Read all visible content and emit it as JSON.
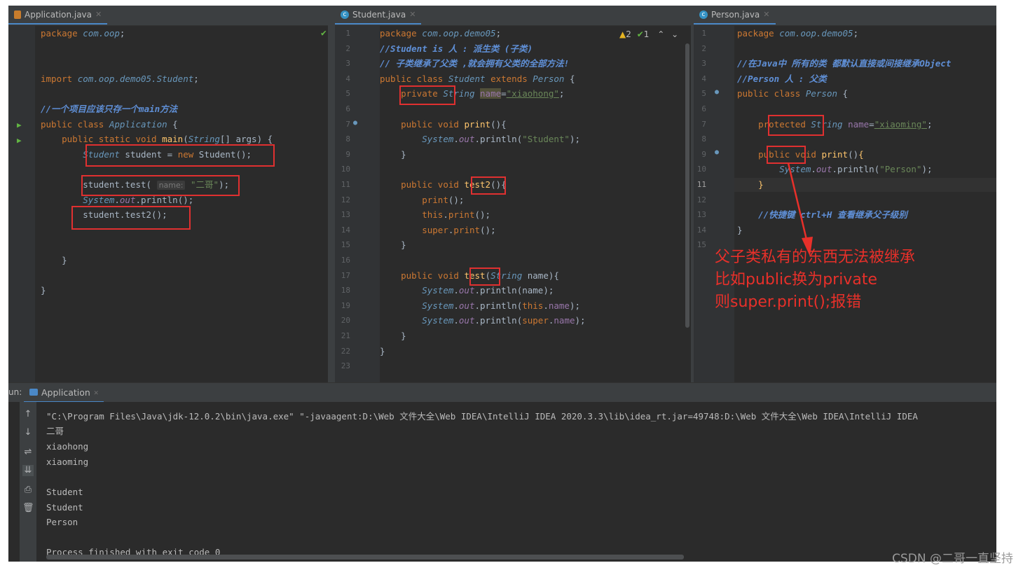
{
  "tabs": {
    "app": "Application.java",
    "student": "Student.java",
    "person": "Person.java"
  },
  "inspection": {
    "warnings": "2",
    "checks": "1"
  },
  "run": {
    "prefix": "un:",
    "tab_label": "Application",
    "output": [
      "\"C:\\Program Files\\Java\\jdk-12.0.2\\bin\\java.exe\" \"-javaagent:D:\\Web 文件大全\\Web IDEA\\IntelliJ IDEA 2020.3.3\\lib\\idea_rt.jar=49748:D:\\Web 文件大全\\Web IDEA\\IntelliJ IDEA",
      "二哥",
      "xiaohong",
      "xiaoming",
      "",
      "Student",
      "Student",
      "Person",
      "",
      "Process finished with exit code 0"
    ]
  },
  "annotation": [
    "父子类私有的东西无法被继承",
    "比如public换为private",
    "则super.print();报错"
  ],
  "watermark": "CSDN @二哥一直坚持",
  "colors": {
    "highlight_box": "#e03030",
    "annotation": "#e8302a",
    "editor_bg": "#2b2b2b"
  }
}
